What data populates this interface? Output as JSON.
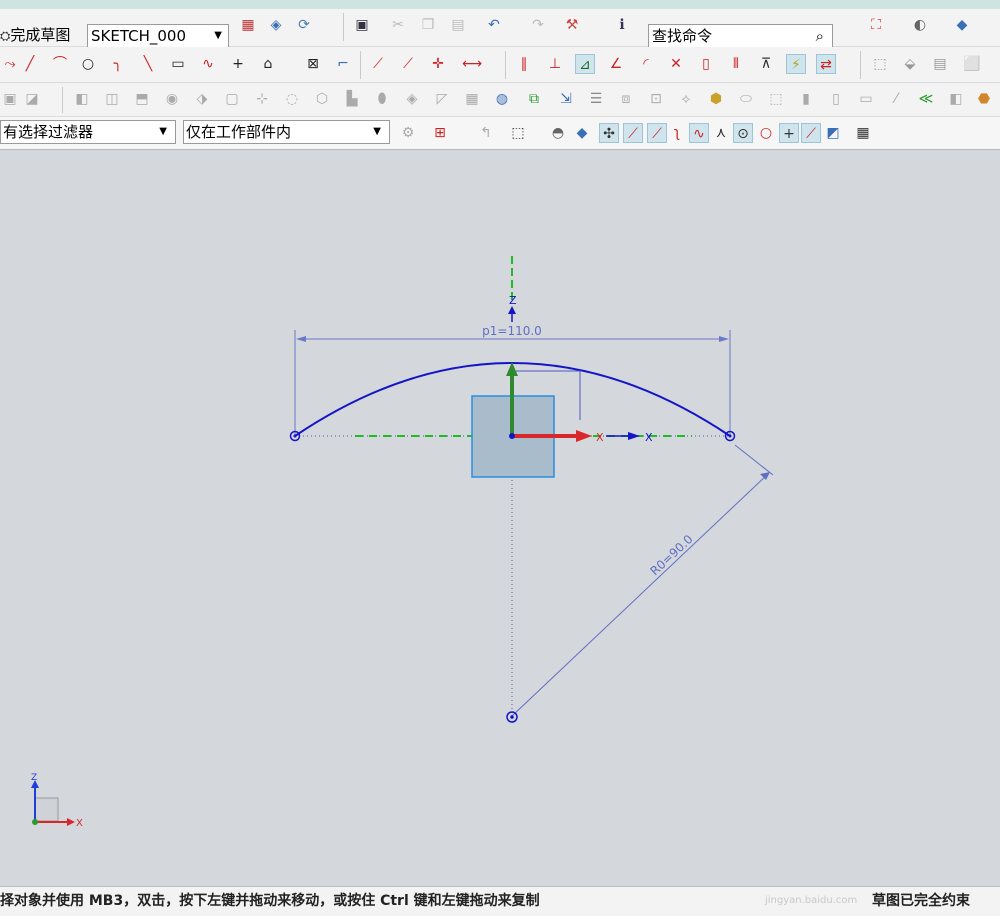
{
  "toolbar": {
    "finish_sketch_label": "完成草图",
    "sketch_name": "SKETCH_000",
    "command_search_placeholder": "查找命令"
  },
  "selection_bar": {
    "type_filter": "有选择过滤器",
    "scope_filter": "仅在工作部件内"
  },
  "sketch": {
    "horizontal_dimension_label": "p1=110.0",
    "radius_dimension_label": "R0=90.0",
    "y_axis_label": "Z",
    "x_axis_label": "X",
    "x_axis_label_outer": "X",
    "geometry_color": "#1515c8",
    "dimension_color": "#5f6fc4",
    "csys_x_color": "#d9262b",
    "csys_z_color": "#2f8a2f",
    "square_fill": "#a8bccc"
  },
  "triad": {
    "z_label": "Z",
    "x_label": "X"
  },
  "status": {
    "prompt": "择对象并使用 MB3，双击，按下左键并拖动来移动，或按住 Ctrl 键和左键拖动来复制",
    "state": "草图已完全约束",
    "watermark": "jingyan.baidu.com"
  }
}
